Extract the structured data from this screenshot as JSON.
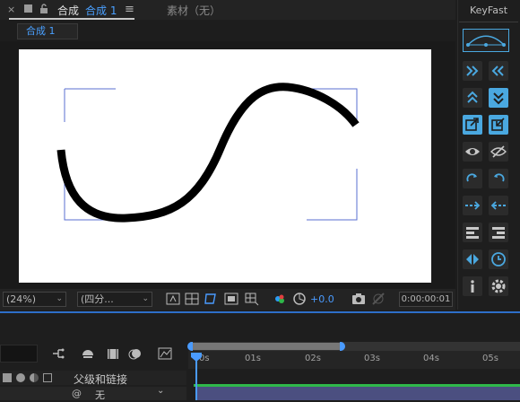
{
  "tabs": {
    "close_glyph": "×",
    "comp_label": "合成",
    "comp_name": "合成 1",
    "menu_glyph": "≡",
    "footage_tab": "素材（无）",
    "subtab": "合成 1"
  },
  "viewer": {
    "zoom": "(24%)",
    "resolution": "(四分...",
    "exposure": "+0.0",
    "timecode": "0:00:00:01"
  },
  "keyfast": {
    "title": "KeyFast",
    "buttons": [
      "bezier-curve-icon",
      "double-chevron-right-icon",
      "double-chevron-left-icon",
      "double-chevron-up-icon",
      "double-chevron-down-icon",
      "export-arrow-icon",
      "import-arrow-icon",
      "eye-icon",
      "eye-off-icon",
      "rotate-clockwise-icon",
      "rotate-counter-icon",
      "dash-arrow-right-icon",
      "dash-arrow-left-icon",
      "align-left-bars-icon",
      "align-right-bars-icon",
      "flip-horizontal-icon",
      "clock-icon",
      "info-icon",
      "gear-icon"
    ],
    "accent": "#4aa8e0"
  },
  "timeline": {
    "column_header": "父级和链接",
    "parent_value": "无",
    "ticks": [
      "0s",
      "01s",
      "02s",
      "03s",
      "04s",
      "05s"
    ]
  },
  "colors": {
    "accent_blue": "#4a9bff",
    "layer_bar": "#4b4f80",
    "work_green": "#2fb84a"
  }
}
